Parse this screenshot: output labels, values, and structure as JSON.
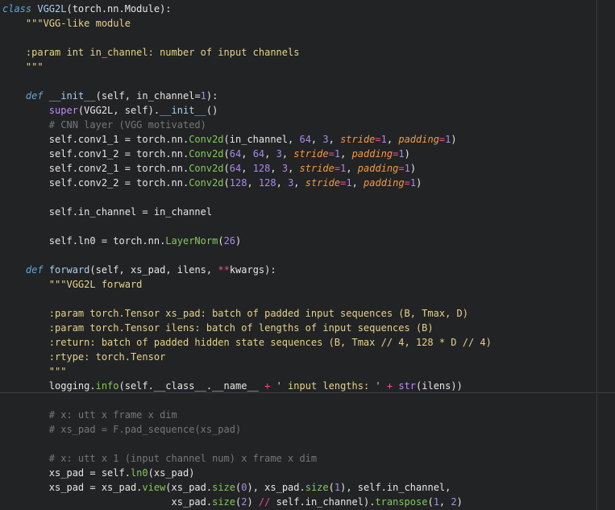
{
  "editor": {
    "background": "#222325",
    "lines": [
      [
        {
          "t": "class",
          "c": "t-kw"
        },
        {
          "t": " ",
          "c": "t-text"
        },
        {
          "t": "VGG2L",
          "c": "t-class"
        },
        {
          "t": "(torch.nn.Module):",
          "c": "t-text"
        }
      ],
      [
        {
          "t": "    \"\"\"VGG-like module",
          "c": "t-string"
        }
      ],
      [],
      [
        {
          "t": "    :param int in_channel: number of input channels",
          "c": "t-string"
        }
      ],
      [
        {
          "t": "    \"\"\"",
          "c": "t-string"
        }
      ],
      [],
      [
        {
          "t": "    ",
          "c": "t-text"
        },
        {
          "t": "def",
          "c": "t-kw"
        },
        {
          "t": " ",
          "c": "t-text"
        },
        {
          "t": "__init__",
          "c": "t-func"
        },
        {
          "t": "(self, in_channel=",
          "c": "t-text"
        },
        {
          "t": "1",
          "c": "t-number"
        },
        {
          "t": "):",
          "c": "t-text"
        }
      ],
      [
        {
          "t": "        ",
          "c": "t-text"
        },
        {
          "t": "super",
          "c": "t-builtin"
        },
        {
          "t": "(VGG2L, self).",
          "c": "t-text"
        },
        {
          "t": "__init__",
          "c": "t-func"
        },
        {
          "t": "()",
          "c": "t-text"
        }
      ],
      [
        {
          "t": "        # CNN layer (VGG motivated)",
          "c": "t-comment"
        }
      ],
      [
        {
          "t": "        self.conv1_1 = torch.nn.",
          "c": "t-text"
        },
        {
          "t": "Conv2d",
          "c": "t-call"
        },
        {
          "t": "(in_channel, ",
          "c": "t-text"
        },
        {
          "t": "64",
          "c": "t-number"
        },
        {
          "t": ", ",
          "c": "t-text"
        },
        {
          "t": "3",
          "c": "t-number"
        },
        {
          "t": ", ",
          "c": "t-text"
        },
        {
          "t": "stride",
          "c": "t-keyword-arg"
        },
        {
          "t": "=",
          "c": "t-operator"
        },
        {
          "t": "1",
          "c": "t-number"
        },
        {
          "t": ", ",
          "c": "t-text"
        },
        {
          "t": "padding",
          "c": "t-keyword-arg"
        },
        {
          "t": "=",
          "c": "t-operator"
        },
        {
          "t": "1",
          "c": "t-number"
        },
        {
          "t": ")",
          "c": "t-text"
        }
      ],
      [
        {
          "t": "        self.conv1_2 = torch.nn.",
          "c": "t-text"
        },
        {
          "t": "Conv2d",
          "c": "t-call"
        },
        {
          "t": "(",
          "c": "t-text"
        },
        {
          "t": "64",
          "c": "t-number"
        },
        {
          "t": ", ",
          "c": "t-text"
        },
        {
          "t": "64",
          "c": "t-number"
        },
        {
          "t": ", ",
          "c": "t-text"
        },
        {
          "t": "3",
          "c": "t-number"
        },
        {
          "t": ", ",
          "c": "t-text"
        },
        {
          "t": "stride",
          "c": "t-keyword-arg"
        },
        {
          "t": "=",
          "c": "t-operator"
        },
        {
          "t": "1",
          "c": "t-number"
        },
        {
          "t": ", ",
          "c": "t-text"
        },
        {
          "t": "padding",
          "c": "t-keyword-arg"
        },
        {
          "t": "=",
          "c": "t-operator"
        },
        {
          "t": "1",
          "c": "t-number"
        },
        {
          "t": ")",
          "c": "t-text"
        }
      ],
      [
        {
          "t": "        self.conv2_1 = torch.nn.",
          "c": "t-text"
        },
        {
          "t": "Conv2d",
          "c": "t-call"
        },
        {
          "t": "(",
          "c": "t-text"
        },
        {
          "t": "64",
          "c": "t-number"
        },
        {
          "t": ", ",
          "c": "t-text"
        },
        {
          "t": "128",
          "c": "t-number"
        },
        {
          "t": ", ",
          "c": "t-text"
        },
        {
          "t": "3",
          "c": "t-number"
        },
        {
          "t": ", ",
          "c": "t-text"
        },
        {
          "t": "stride",
          "c": "t-keyword-arg"
        },
        {
          "t": "=",
          "c": "t-operator"
        },
        {
          "t": "1",
          "c": "t-number"
        },
        {
          "t": ", ",
          "c": "t-text"
        },
        {
          "t": "padding",
          "c": "t-keyword-arg"
        },
        {
          "t": "=",
          "c": "t-operator"
        },
        {
          "t": "1",
          "c": "t-number"
        },
        {
          "t": ")",
          "c": "t-text"
        }
      ],
      [
        {
          "t": "        self.conv2_2 = torch.nn.",
          "c": "t-text"
        },
        {
          "t": "Conv2d",
          "c": "t-call"
        },
        {
          "t": "(",
          "c": "t-text"
        },
        {
          "t": "128",
          "c": "t-number"
        },
        {
          "t": ", ",
          "c": "t-text"
        },
        {
          "t": "128",
          "c": "t-number"
        },
        {
          "t": ", ",
          "c": "t-text"
        },
        {
          "t": "3",
          "c": "t-number"
        },
        {
          "t": ", ",
          "c": "t-text"
        },
        {
          "t": "stride",
          "c": "t-keyword-arg"
        },
        {
          "t": "=",
          "c": "t-operator"
        },
        {
          "t": "1",
          "c": "t-number"
        },
        {
          "t": ", ",
          "c": "t-text"
        },
        {
          "t": "padding",
          "c": "t-keyword-arg"
        },
        {
          "t": "=",
          "c": "t-operator"
        },
        {
          "t": "1",
          "c": "t-number"
        },
        {
          "t": ")",
          "c": "t-text"
        }
      ],
      [],
      [
        {
          "t": "        self.in_channel = in_channel",
          "c": "t-text"
        }
      ],
      [],
      [
        {
          "t": "        self.ln0 = torch.nn.",
          "c": "t-text"
        },
        {
          "t": "LayerNorm",
          "c": "t-call"
        },
        {
          "t": "(",
          "c": "t-text"
        },
        {
          "t": "26",
          "c": "t-number"
        },
        {
          "t": ")",
          "c": "t-text"
        }
      ],
      [],
      [
        {
          "t": "    ",
          "c": "t-text"
        },
        {
          "t": "def",
          "c": "t-kw"
        },
        {
          "t": " ",
          "c": "t-text"
        },
        {
          "t": "forward",
          "c": "t-func"
        },
        {
          "t": "(self, xs_pad, ilens, ",
          "c": "t-text"
        },
        {
          "t": "**",
          "c": "t-operator"
        },
        {
          "t": "kwargs):",
          "c": "t-text"
        }
      ],
      [
        {
          "t": "        \"\"\"VGG2L forward",
          "c": "t-string"
        }
      ],
      [],
      [
        {
          "t": "        :param torch.Tensor xs_pad: batch of padded input sequences (B, Tmax, D)",
          "c": "t-string"
        }
      ],
      [
        {
          "t": "        :param torch.Tensor ilens: batch of lengths of input sequences (B)",
          "c": "t-string"
        }
      ],
      [
        {
          "t": "        :return: batch of padded hidden state sequences (B, Tmax // 4, 128 * D // 4)",
          "c": "t-string"
        }
      ],
      [
        {
          "t": "        :rtype: torch.Tensor",
          "c": "t-string"
        }
      ],
      [
        {
          "t": "        \"\"\"",
          "c": "t-string"
        }
      ],
      [
        {
          "t": "        logging.",
          "c": "t-text"
        },
        {
          "t": "info",
          "c": "t-call"
        },
        {
          "t": "(self.__class__.__name__ ",
          "c": "t-text"
        },
        {
          "t": "+",
          "c": "t-operator"
        },
        {
          "t": " ",
          "c": "t-text"
        },
        {
          "t": "' input lengths: '",
          "c": "t-string"
        },
        {
          "t": " ",
          "c": "t-text"
        },
        {
          "t": "+",
          "c": "t-operator"
        },
        {
          "t": " ",
          "c": "t-text"
        },
        {
          "t": "str",
          "c": "t-builtin"
        },
        {
          "t": "(ilens))",
          "c": "t-text"
        }
      ],
      [],
      [
        {
          "t": "        # x: utt x frame x dim",
          "c": "t-comment"
        }
      ],
      [
        {
          "t": "        # xs_pad = F.pad_sequence(xs_pad)",
          "c": "t-comment"
        }
      ],
      [],
      [
        {
          "t": "        # x: utt x 1 (input channel num) x frame x dim",
          "c": "t-comment"
        }
      ],
      [
        {
          "t": "        xs_pad = self.",
          "c": "t-text"
        },
        {
          "t": "ln0",
          "c": "t-call"
        },
        {
          "t": "(xs_pad)",
          "c": "t-text"
        }
      ],
      [
        {
          "t": "        xs_pad = xs_pad.",
          "c": "t-text"
        },
        {
          "t": "view",
          "c": "t-call"
        },
        {
          "t": "(xs_pad.",
          "c": "t-text"
        },
        {
          "t": "size",
          "c": "t-call"
        },
        {
          "t": "(",
          "c": "t-text"
        },
        {
          "t": "0",
          "c": "t-number"
        },
        {
          "t": "), xs_pad.",
          "c": "t-text"
        },
        {
          "t": "size",
          "c": "t-call"
        },
        {
          "t": "(",
          "c": "t-text"
        },
        {
          "t": "1",
          "c": "t-number"
        },
        {
          "t": "), self.in_channel,",
          "c": "t-text"
        }
      ],
      [
        {
          "t": "                             xs_pad.",
          "c": "t-text"
        },
        {
          "t": "size",
          "c": "t-call"
        },
        {
          "t": "(",
          "c": "t-text"
        },
        {
          "t": "2",
          "c": "t-number"
        },
        {
          "t": ") ",
          "c": "t-text"
        },
        {
          "t": "//",
          "c": "t-operator"
        },
        {
          "t": " self.in_channel).",
          "c": "t-text"
        },
        {
          "t": "transpose",
          "c": "t-call"
        },
        {
          "t": "(",
          "c": "t-text"
        },
        {
          "t": "1",
          "c": "t-number"
        },
        {
          "t": ", ",
          "c": "t-text"
        },
        {
          "t": "2",
          "c": "t-number"
        },
        {
          "t": ")",
          "c": "t-text"
        }
      ]
    ]
  }
}
